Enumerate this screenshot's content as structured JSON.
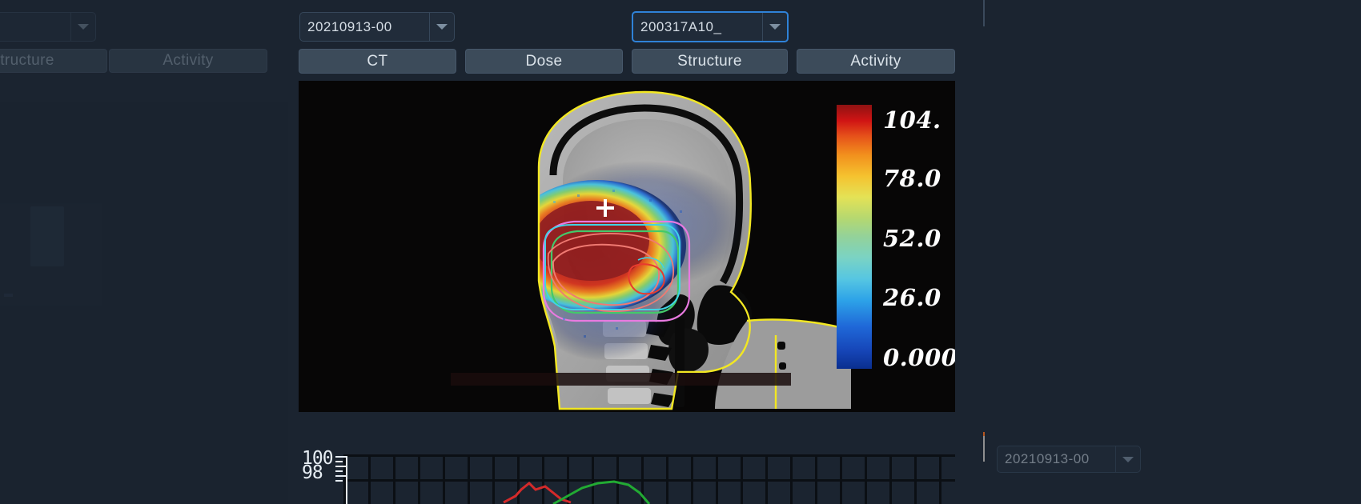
{
  "app": {
    "theme_bg": "#1b2430",
    "panel_bg": "#212c3a",
    "button_bg": "#3c4b5a",
    "accent_focus": "#2f82d8",
    "text": "#d6dee6"
  },
  "left_panel": {
    "state": "dimmed-clipped",
    "combo": {
      "value": "",
      "icon": "chevron-down-icon"
    },
    "tabs": [
      {
        "label": "tructure",
        "truncated": true
      },
      {
        "label": "Activity",
        "truncated": false
      }
    ]
  },
  "center_panel": {
    "plan_combo": {
      "value": "20210913-00",
      "icon": "chevron-down-icon",
      "focused": false
    },
    "patient_combo": {
      "value": "200317A10_",
      "icon": "chevron-down-icon",
      "focused": true
    },
    "tabs": [
      {
        "label": "CT",
        "active": false
      },
      {
        "label": "Dose",
        "active": false
      },
      {
        "label": "Structure",
        "active": false
      },
      {
        "label": "Activity",
        "active": false
      }
    ],
    "viewport": {
      "modality": "CT sagittal with dose overlay",
      "crosshair": "crosshair-marker",
      "background": "#070606"
    },
    "colorbar": {
      "colormap": "jet",
      "unit_max_partial": "104.",
      "labels": [
        "104.",
        "78.0",
        "52.0",
        "26.0",
        "0.000"
      ],
      "values": [
        104.0,
        78.0,
        52.0,
        26.0,
        0.0
      ]
    }
  },
  "right_panel": {
    "combo": {
      "value": "20210913-00",
      "icon": "chevron-down-icon"
    }
  },
  "chart_data": {
    "type": "line",
    "title": "",
    "xlabel": "",
    "ylabel": "",
    "ytick_labels": [
      "100",
      "98"
    ],
    "ylim": [
      98,
      100
    ],
    "grid": true,
    "legend": "none",
    "series": [
      {
        "name": "series-red",
        "color": "#d42a2a",
        "x": [
          0,
          1,
          2,
          3,
          4,
          5,
          6,
          7,
          8
        ],
        "values": [
          98.2,
          98.5,
          99.0,
          99.5,
          99.1,
          99.3,
          98.9,
          98.4,
          98.1
        ]
      },
      {
        "name": "series-green",
        "color": "#22aa33",
        "x": [
          6,
          7,
          8,
          9,
          10,
          11,
          12,
          13
        ],
        "values": [
          98.0,
          98.6,
          99.2,
          99.5,
          99.6,
          99.4,
          98.8,
          98.0
        ]
      }
    ]
  }
}
